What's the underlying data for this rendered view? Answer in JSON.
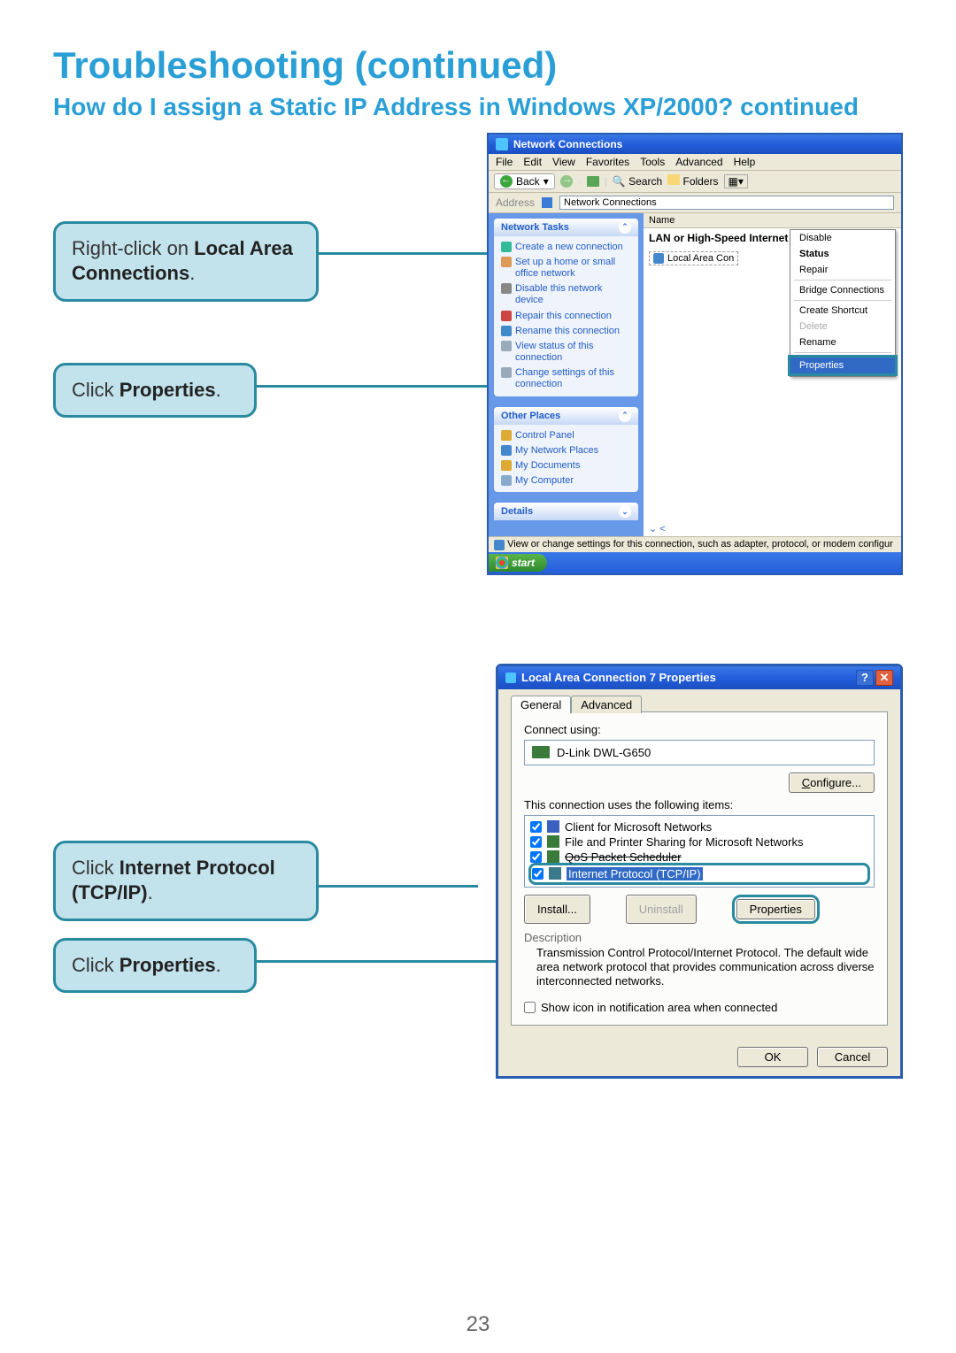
{
  "page": {
    "title": "Troubleshooting (continued)",
    "subtitle": "How do I assign a Static IP Address in Windows XP/2000? continued",
    "number": "23"
  },
  "callouts": {
    "c1_pre": "Right-click on ",
    "c1_bold": "Local Area Connections",
    "c1_post": ".",
    "c2_pre": "Click ",
    "c2_bold": "Properties",
    "c2_post": ".",
    "c3_pre": "Click ",
    "c3_bold": "Internet Protocol (TCP/IP)",
    "c3_post": ".",
    "c4_pre": "Click ",
    "c4_bold": "Properties",
    "c4_post": "."
  },
  "win1": {
    "title": "Network Connections",
    "menus": [
      "File",
      "Edit",
      "View",
      "Favorites",
      "Tools",
      "Advanced",
      "Help"
    ],
    "toolbar": {
      "back": "Back",
      "search": "Search",
      "folders": "Folders"
    },
    "addr_label": "Address",
    "addr_value": "Network Connections",
    "col_name": "Name",
    "section": "LAN or High-Speed Internet",
    "conn_item": "Local Area Con",
    "tasks_head": "Network Tasks",
    "tasks": [
      "Create a new connection",
      "Set up a home or small office network",
      "Disable this network device",
      "Repair this connection",
      "Rename this connection",
      "View status of this connection",
      "Change settings of this connection"
    ],
    "other_head": "Other Places",
    "other": [
      "Control Panel",
      "My Network Places",
      "My Documents",
      "My Computer"
    ],
    "details_head": "Details",
    "context": {
      "disable": "Disable",
      "status": "Status",
      "repair": "Repair",
      "bridge": "Bridge Connections",
      "shortcut": "Create Shortcut",
      "delete": "Delete",
      "rename": "Rename",
      "properties": "Properties"
    },
    "statusbar": "View or change settings for this connection, such as adapter, protocol, or modem configur",
    "start": "start"
  },
  "win2": {
    "title": "Local Area Connection 7 Properties",
    "tab_general": "General",
    "tab_advanced": "Advanced",
    "connect_using": "Connect using:",
    "adapter": "D-Link DWL-G650",
    "configure": "Configure...",
    "uses_items": "This connection uses the following items:",
    "items": [
      "Client for Microsoft Networks",
      "File and Printer Sharing for Microsoft Networks",
      "QoS Packet Scheduler",
      "Internet Protocol (TCP/IP)"
    ],
    "install": "Install...",
    "uninstall": "Uninstall",
    "properties": "Properties",
    "desc_label": "Description",
    "desc_text": "Transmission Control Protocol/Internet Protocol. The default wide area network protocol that provides communication across diverse interconnected networks.",
    "show_icon": "Show icon in notification area when connected",
    "ok": "OK",
    "cancel": "Cancel"
  }
}
